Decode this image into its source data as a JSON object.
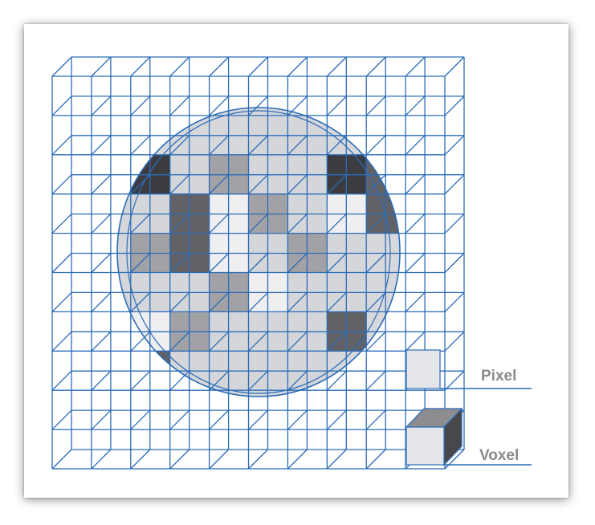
{
  "labels": {
    "pixel": "Pixel",
    "voxel": "Voxel"
  },
  "colors": {
    "grid": "#2b6cb8",
    "sphere_fill": "#d6d8dc",
    "label": "#8a8a8a",
    "shade_very_light": "#efeff1",
    "shade_light": "#d4d6da",
    "shade_mid": "#a2a2a6",
    "shade_dark": "#626266",
    "shade_very_dark": "#3c3c40"
  }
}
